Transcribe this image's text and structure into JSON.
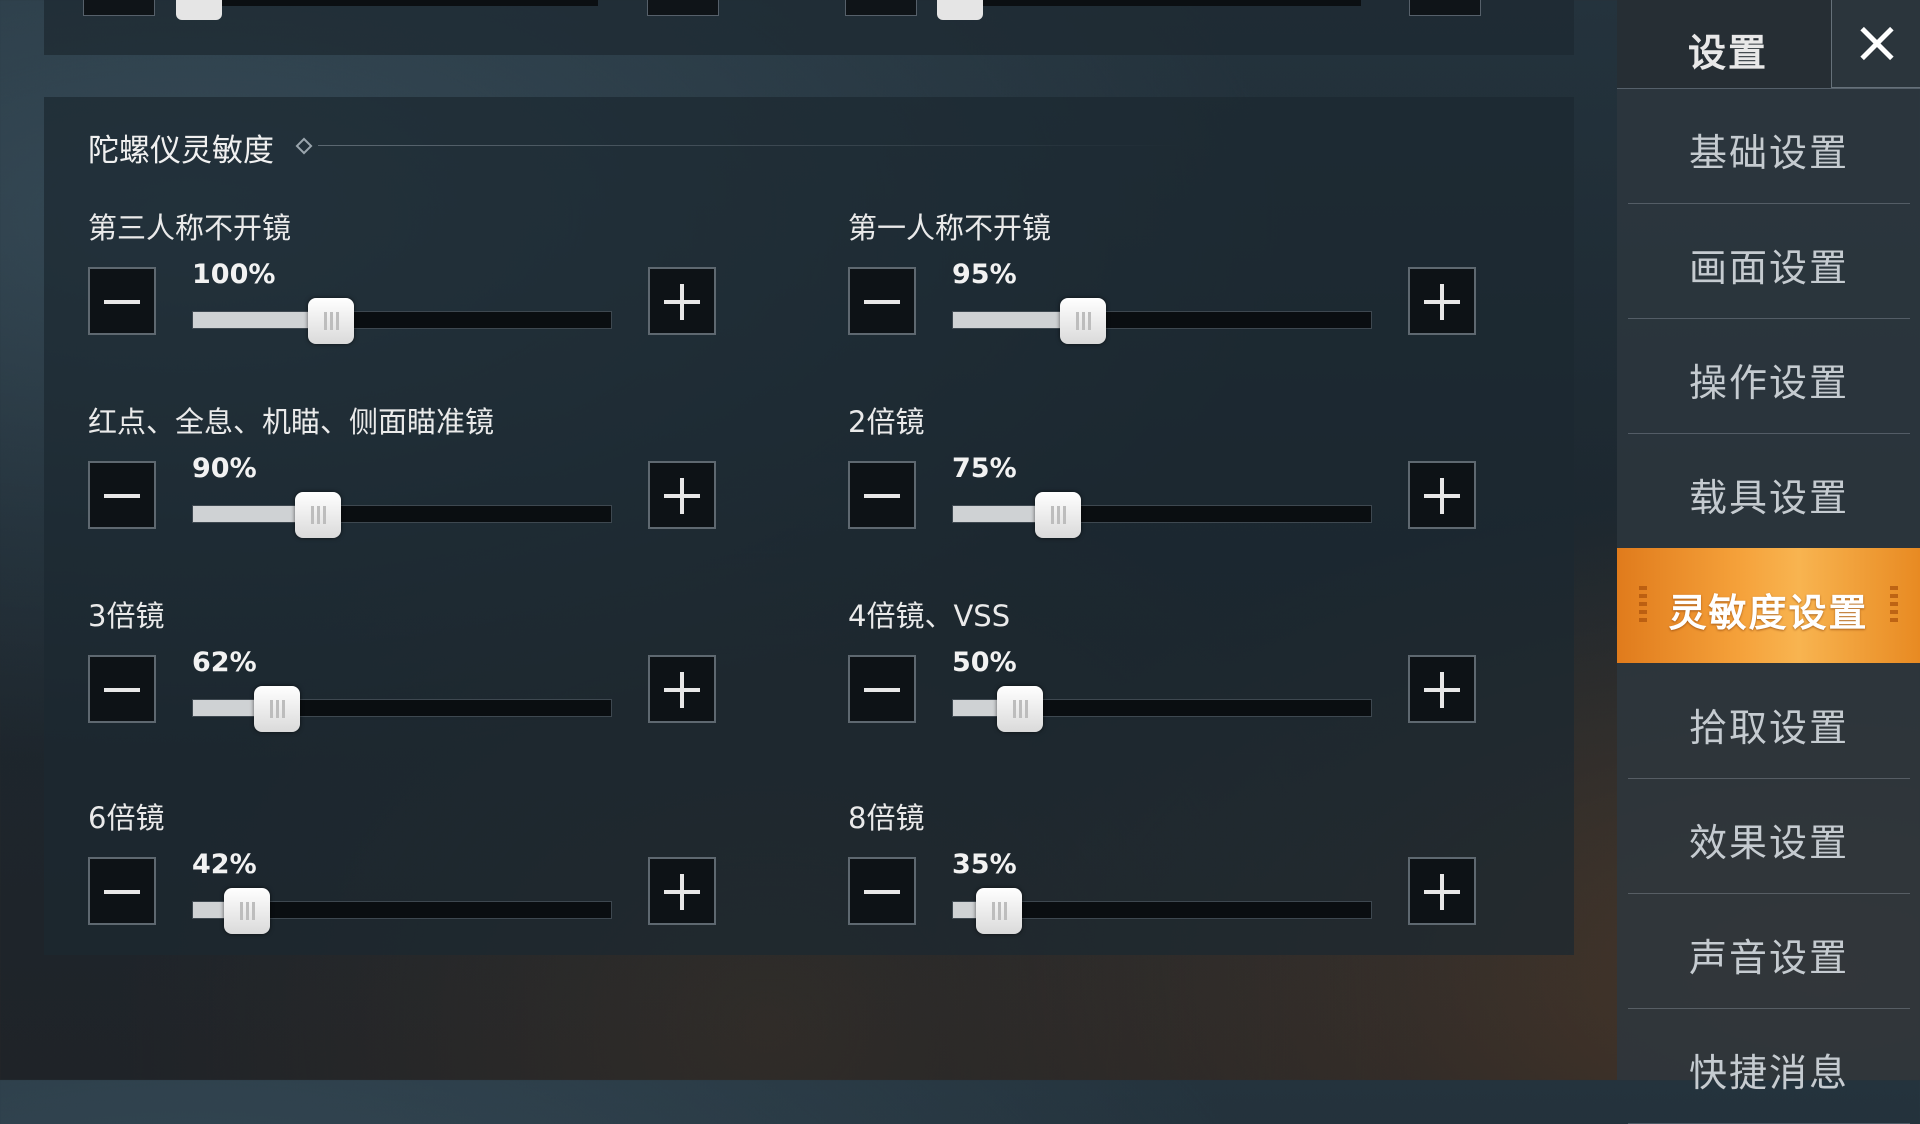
{
  "sidebar": {
    "title": "设置",
    "items": [
      {
        "label": "基础设置",
        "active": false
      },
      {
        "label": "画面设置",
        "active": false
      },
      {
        "label": "操作设置",
        "active": false
      },
      {
        "label": "载具设置",
        "active": false
      },
      {
        "label": "灵敏度设置",
        "active": true
      },
      {
        "label": "拾取设置",
        "active": false
      },
      {
        "label": "效果设置",
        "active": false
      },
      {
        "label": "声音设置",
        "active": false
      },
      {
        "label": "快捷消息",
        "active": false
      }
    ]
  },
  "section": {
    "title": "陀螺仪灵敏度",
    "sliders": [
      {
        "label": "第三人称不开镜",
        "value_text": "100%",
        "level": 0.33
      },
      {
        "label": "第一人称不开镜",
        "value_text": "95%",
        "level": 0.31
      },
      {
        "label": "红点、全息、机瞄、侧面瞄准镜",
        "value_text": "90%",
        "level": 0.3
      },
      {
        "label": "2倍镜",
        "value_text": "75%",
        "level": 0.25
      },
      {
        "label": "3倍镜",
        "value_text": "62%",
        "level": 0.2
      },
      {
        "label": "4倍镜、VSS",
        "value_text": "50%",
        "level": 0.16
      },
      {
        "label": "6倍镜",
        "value_text": "42%",
        "level": 0.13
      },
      {
        "label": "8倍镜",
        "value_text": "35%",
        "level": 0.11
      }
    ]
  },
  "colors": {
    "accent": "#f5a13a",
    "panel": "#1c2830"
  }
}
